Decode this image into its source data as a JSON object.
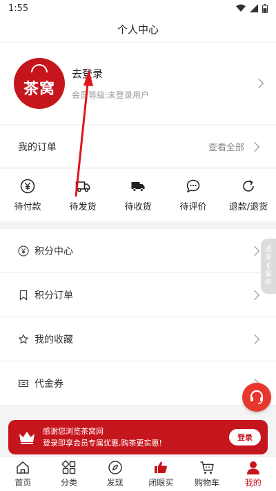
{
  "status_bar": {
    "time": "1:55"
  },
  "header": {
    "title": "个人中心"
  },
  "profile": {
    "logo_text": "茶窝",
    "login_link": "去登录",
    "member_level": "会员等级:未登录用户"
  },
  "orders": {
    "title": "我的订单",
    "view_all": "查看全部",
    "statuses": [
      {
        "label": "待付款",
        "icon": "yen-circle-icon"
      },
      {
        "label": "待发货",
        "icon": "truck-outline-icon"
      },
      {
        "label": "待收货",
        "icon": "truck-filled-icon"
      },
      {
        "label": "待评价",
        "icon": "chat-bubble-icon"
      },
      {
        "label": "退款/退货",
        "icon": "refresh-icon"
      }
    ]
  },
  "menu": [
    {
      "label": "积分中心",
      "icon": "points-icon"
    },
    {
      "label": "积分订单",
      "icon": "bookmark-icon"
    },
    {
      "label": "我的收藏",
      "icon": "star-icon"
    },
    {
      "label": "代金券",
      "icon": "coupon-icon"
    }
  ],
  "side_tab": {
    "line1": "选",
    "line2": "茶",
    "line3": "服",
    "line4": "务"
  },
  "banner": {
    "line1": "感谢您浏览茶窝网",
    "line2": "登录即享会员专属优惠,购茶更实惠!",
    "button": "登录"
  },
  "tabbar": [
    {
      "label": "首页",
      "icon": "home-icon"
    },
    {
      "label": "分类",
      "icon": "category-icon"
    },
    {
      "label": "发现",
      "icon": "compass-icon"
    },
    {
      "label": "闭眼买",
      "icon": "thumbs-up-icon"
    },
    {
      "label": "购物车",
      "icon": "cart-icon"
    },
    {
      "label": "我的",
      "icon": "user-icon",
      "active": true
    }
  ],
  "colors": {
    "brand_red": "#c6161d",
    "accent_red": "#e8372c",
    "annotation_arrow": "#e0151b"
  }
}
